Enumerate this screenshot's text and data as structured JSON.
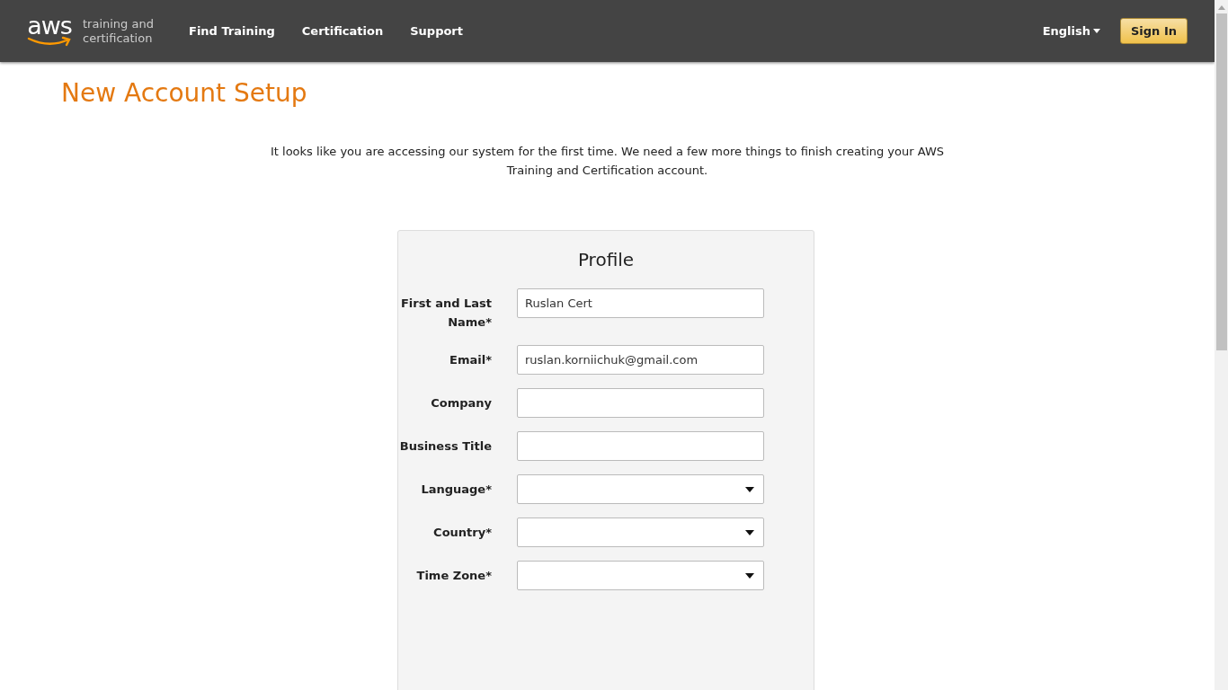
{
  "header": {
    "logo": {
      "wordmark": "aws",
      "tagline": "training and certification"
    },
    "nav": [
      "Find Training",
      "Certification",
      "Support"
    ],
    "language": "English",
    "sign_in": "Sign In"
  },
  "page_title": "New Account Setup",
  "intro": "It looks like you are accessing our system for the first time. We need a few more things to finish creating your AWS Training and Certification account.",
  "profile": {
    "title": "Profile",
    "fields": [
      {
        "label": "First and Last Name*",
        "kind": "text",
        "value": "Ruslan Cert"
      },
      {
        "label": "Email*",
        "kind": "text",
        "value": "ruslan.korniichuk@gmail.com"
      },
      {
        "label": "Company",
        "kind": "text"
      },
      {
        "label": "Business Title",
        "kind": "text"
      },
      {
        "label": "Language*",
        "kind": "select"
      },
      {
        "label": "Country*",
        "kind": "select"
      },
      {
        "label": "Time Zone*",
        "kind": "select"
      }
    ]
  }
}
